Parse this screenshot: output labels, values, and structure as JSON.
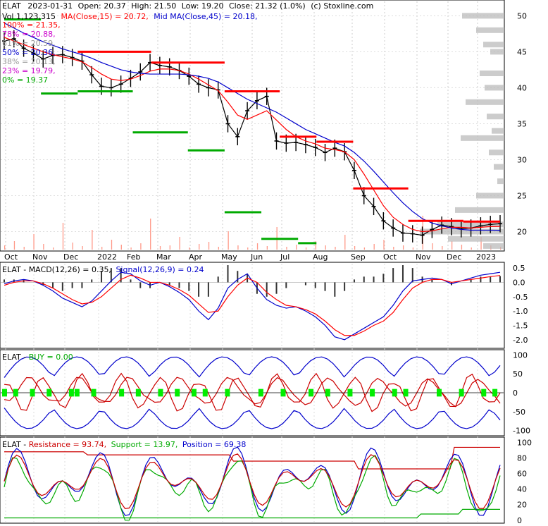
{
  "header": {
    "ticker": "ELAT",
    "date": "2023-01-31",
    "open": "Open: 20.37",
    "high": "High: 21.50",
    "low": "Low: 19.20",
    "close": "Close: 21.32 (1.0%)",
    "source": "(c) Stoxline.com",
    "volume": "Vol 1,123,315",
    "ma15": "MA(Close,15) = 20.72,",
    "ma45": "Mid MA(Close,45) = 20.18,"
  },
  "fib_levels": [
    {
      "label": "100% = 21.35,",
      "color": "#ff0000"
    },
    {
      "label": "78% = 20.88,",
      "color": "#cc00cc"
    },
    {
      "label": "61% = 20.59,",
      "color": "#999999"
    },
    {
      "label": "50% = 20.36,",
      "color": "#0000cc"
    },
    {
      "label": "38% = 20.13,",
      "color": "#999999"
    },
    {
      "label": "23% = 19.79,",
      "color": "#cc00cc"
    },
    {
      "label": "0% = 19.37",
      "color": "#00aa00"
    }
  ],
  "colors": {
    "ma15": "#ff0000",
    "ma45": "#0000cc",
    "support": "#00aa00",
    "resistance": "#ff0000",
    "macd": "#0000cc",
    "signal": "#ff0000",
    "buy_bars": "#00ee00",
    "volume": "#ff9988",
    "profile": "#bbbbbb"
  },
  "chart_data": [
    {
      "type": "line",
      "panel": "price",
      "x_ticks": [
        "Oct",
        "Nov",
        "Dec",
        "2022",
        "Feb",
        "Mar",
        "Apr",
        "May",
        "Jun",
        "Jul",
        "Aug",
        "Sep",
        "Oct",
        "Nov",
        "Dec",
        "2023"
      ],
      "y_ticks": [
        20,
        25,
        30,
        35,
        40,
        45,
        50
      ],
      "ylim": [
        17.5,
        52
      ],
      "close_series": [
        46.5,
        46.8,
        45.5,
        44.8,
        44.0,
        44.5,
        44.6,
        44.2,
        43.7,
        41.8,
        40.2,
        40.0,
        40.5,
        41.3,
        42.2,
        43.5,
        43.1,
        42.9,
        42.4,
        41.6,
        40.5,
        40.0,
        39.7,
        35.0,
        33.2,
        36.8,
        38.2,
        38.8,
        32.6,
        32.3,
        32.4,
        32.1,
        31.7,
        31.0,
        31.6,
        31.1,
        28.5,
        25.0,
        23.5,
        21.5,
        20.5,
        19.8,
        19.7,
        19.5,
        20.3,
        20.9,
        20.7,
        20.4,
        20.5,
        20.8,
        21.0,
        21.1
      ],
      "ma15_series": [
        47.0,
        46.5,
        46.0,
        45.5,
        45.0,
        44.6,
        44.3,
        44.0,
        43.6,
        42.8,
        41.9,
        41.2,
        41.0,
        41.2,
        41.7,
        42.3,
        42.6,
        42.6,
        42.4,
        41.9,
        41.2,
        40.4,
        39.6,
        38.0,
        36.2,
        35.6,
        36.2,
        36.8,
        35.5,
        34.2,
        33.2,
        32.6,
        32.2,
        31.6,
        31.4,
        31.1,
        30.0,
        28.0,
        25.8,
        23.6,
        22.0,
        21.0,
        20.3,
        20.0,
        20.1,
        20.4,
        20.6,
        20.6,
        20.5,
        20.6,
        20.7,
        20.72
      ],
      "ma45_series": [
        49.0,
        48.3,
        47.6,
        47.0,
        46.4,
        45.9,
        45.4,
        45.0,
        44.6,
        44.1,
        43.5,
        43.0,
        42.5,
        42.2,
        42.0,
        41.9,
        41.9,
        41.9,
        41.9,
        41.8,
        41.6,
        41.3,
        40.8,
        40.0,
        39.2,
        38.4,
        37.8,
        37.2,
        36.6,
        35.8,
        35.0,
        34.2,
        33.6,
        33.0,
        32.4,
        31.9,
        31.0,
        29.8,
        28.4,
        26.9,
        25.4,
        24.0,
        22.8,
        21.8,
        21.2,
        20.8,
        20.5,
        20.3,
        20.2,
        20.2,
        20.2,
        20.18
      ],
      "resistance_segments": [
        [
          45,
          4,
          8
        ],
        [
          43.5,
          8,
          12
        ],
        [
          39.5,
          12,
          15
        ],
        [
          33.2,
          15,
          17
        ],
        [
          32.5,
          17,
          19
        ],
        [
          26.0,
          19,
          22
        ],
        [
          21.5,
          22,
          25
        ],
        [
          21.4,
          25,
          27
        ]
      ],
      "support_segments": [
        [
          49.5,
          0,
          2
        ],
        [
          39.2,
          2,
          4
        ],
        [
          39.5,
          4,
          7
        ],
        [
          33.8,
          7,
          10
        ],
        [
          31.3,
          10,
          12
        ],
        [
          22.7,
          12,
          14
        ],
        [
          19.0,
          14,
          16
        ],
        [
          18.4,
          16,
          17
        ]
      ]
    },
    {
      "type": "line",
      "panel": "macd",
      "title": "ELAT - MACD(12,26) = 0.35, Signal(12,26,9) = 0.24",
      "y_ticks": [
        0.5,
        0.0,
        -0.5,
        -1.0,
        -1.5,
        -2.0
      ],
      "ylim": [
        -2.25,
        0.65
      ],
      "macd_series": [
        -0.05,
        0.05,
        0.1,
        0.05,
        -0.1,
        -0.3,
        -0.55,
        -0.7,
        -0.85,
        -0.65,
        -0.3,
        0.05,
        0.35,
        0.3,
        0.05,
        -0.1,
        0.0,
        -0.15,
        -0.35,
        -0.6,
        -1.0,
        -1.3,
        -0.9,
        -0.2,
        0.1,
        0.3,
        -0.2,
        -0.6,
        -0.8,
        -0.9,
        -0.85,
        -1.0,
        -1.2,
        -1.5,
        -1.9,
        -2.0,
        -1.8,
        -1.6,
        -1.4,
        -1.2,
        -0.8,
        -0.3,
        0.05,
        0.1,
        0.15,
        0.1,
        -0.05,
        0.05,
        0.15,
        0.25,
        0.3,
        0.35
      ],
      "signal_series": [
        -0.1,
        0.0,
        0.05,
        0.05,
        -0.05,
        -0.2,
        -0.4,
        -0.6,
        -0.75,
        -0.7,
        -0.5,
        -0.2,
        0.1,
        0.25,
        0.15,
        0.0,
        0.0,
        -0.1,
        -0.25,
        -0.45,
        -0.75,
        -1.05,
        -1.0,
        -0.5,
        -0.1,
        0.15,
        0.0,
        -0.35,
        -0.6,
        -0.8,
        -0.85,
        -0.95,
        -1.1,
        -1.35,
        -1.65,
        -1.85,
        -1.85,
        -1.7,
        -1.5,
        -1.35,
        -1.05,
        -0.6,
        -0.2,
        0.0,
        0.1,
        0.1,
        0.0,
        0.05,
        0.1,
        0.15,
        0.2,
        0.24
      ]
    },
    {
      "type": "line",
      "panel": "buy",
      "title": "ELAT - BUY = 0.00",
      "y_ticks": [
        100,
        50,
        0,
        -50,
        -100
      ],
      "ylim": [
        -110,
        110
      ]
    },
    {
      "type": "line",
      "panel": "position",
      "title": "ELAT - Resistance = 93.74, Support = 13.97, Position = 69.38",
      "y_ticks": [
        100,
        80,
        60,
        40,
        20,
        0
      ],
      "ylim": [
        -2,
        105
      ]
    }
  ],
  "panel_titles": {
    "macd_prefix": "ELAT - ",
    "macd_1": "MACD(12,26) = 0.35,",
    "macd_2": "Signal(12,26,9) = 0.24",
    "buy_prefix": "ELAT - ",
    "buy_1": "BUY = 0.00",
    "pos_prefix": "ELAT - ",
    "pos_1": "Resistance = 93.74,",
    "pos_2": "Support = 13.97,",
    "pos_3": "Position = 69.38"
  }
}
